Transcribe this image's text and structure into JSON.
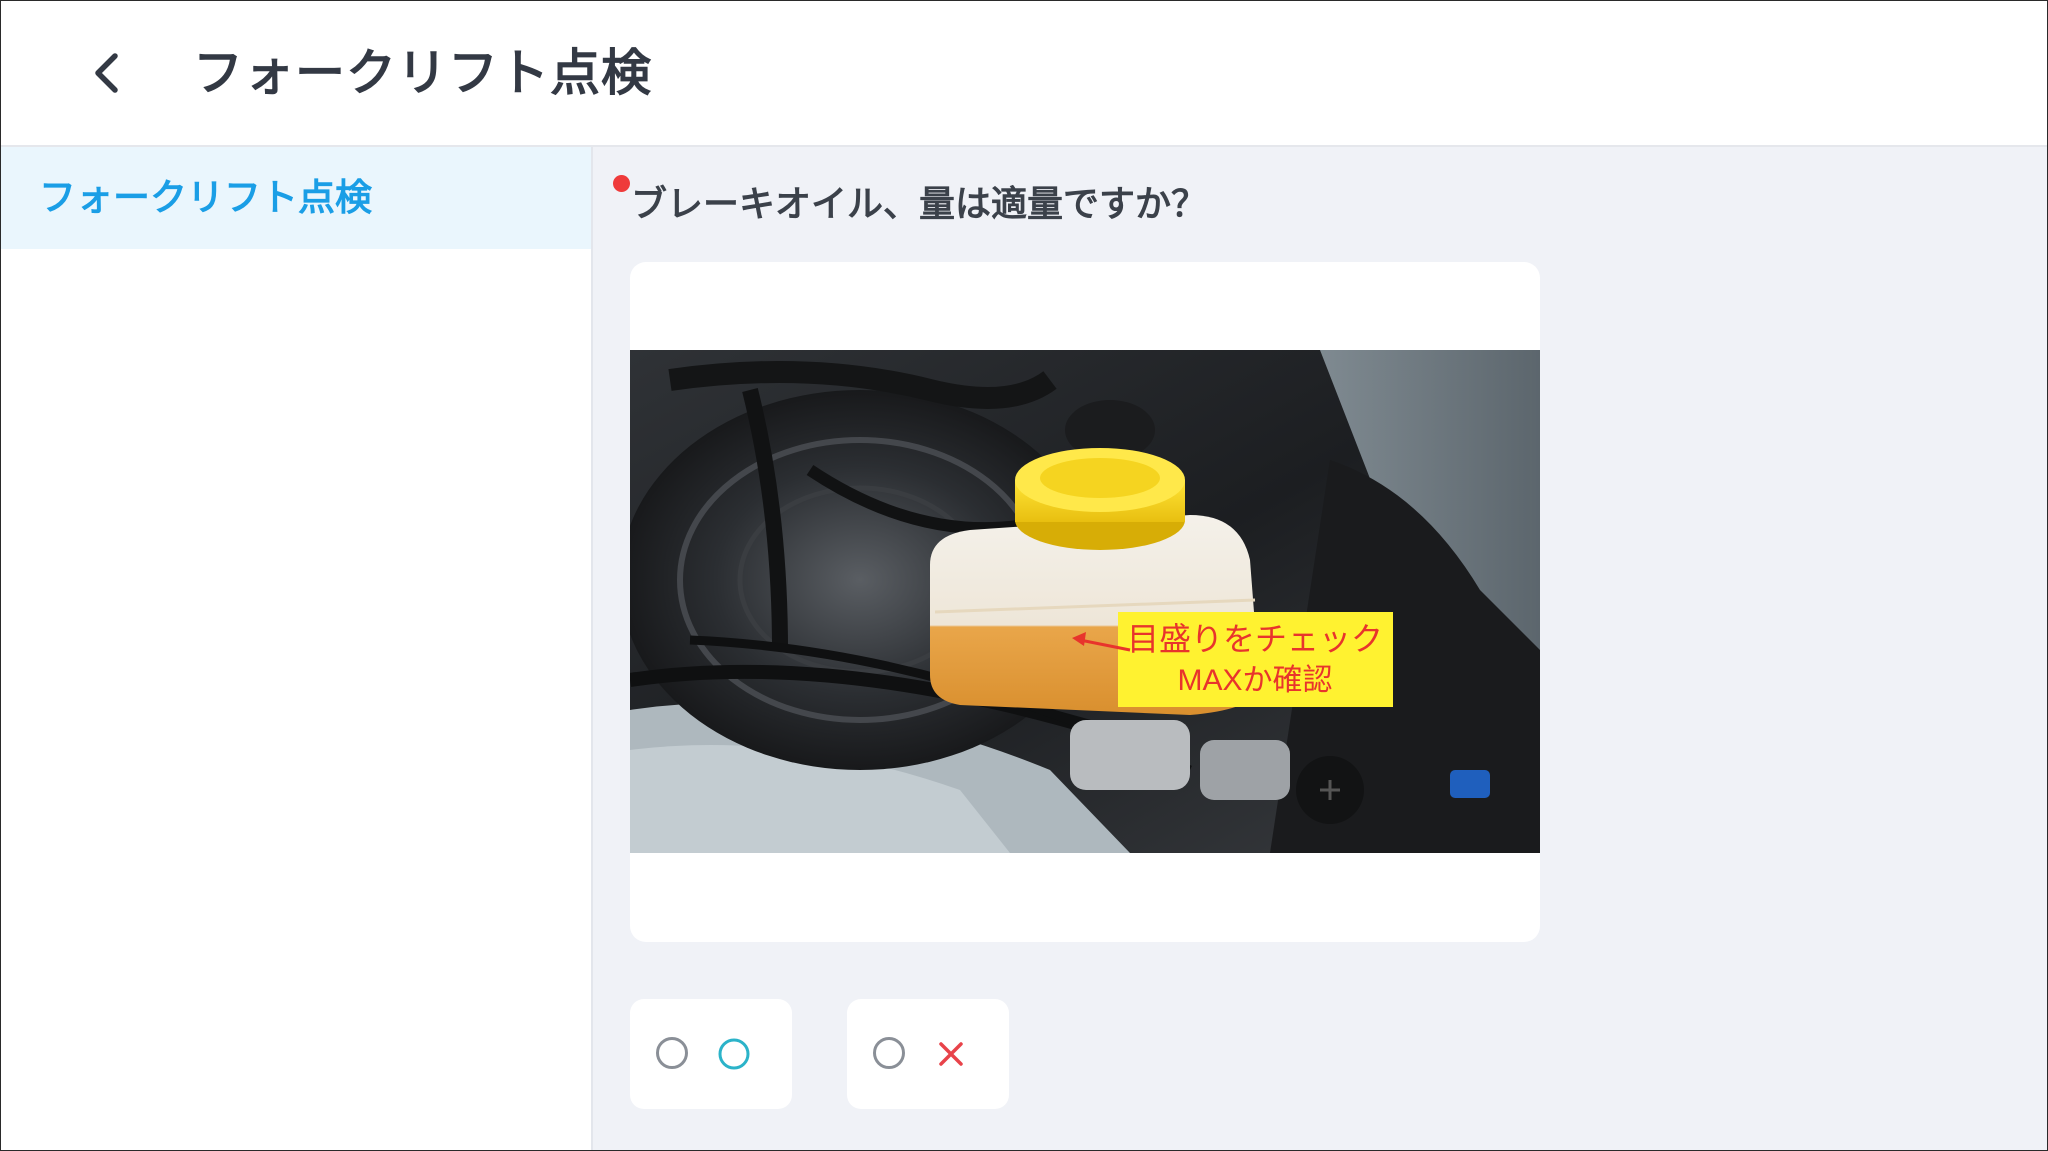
{
  "header": {
    "title": "フォークリフト点検",
    "back_icon": "chevron-left-icon"
  },
  "sidebar": {
    "items": [
      {
        "label": "フォークリフト点検",
        "active": true
      }
    ]
  },
  "question": {
    "text": "ブレーキオイル、量は適量ですか？",
    "required": true,
    "image": {
      "annotation_line1": "目盛りをチェック",
      "annotation_line2": "MAXか確認"
    },
    "options": [
      {
        "symbol": "◯",
        "icon": "circle-icon",
        "color": "#2bb3c9",
        "selected": false
      },
      {
        "symbol": "×",
        "icon": "cross-icon",
        "color": "#e8434a",
        "selected": false
      }
    ]
  },
  "colors": {
    "accent": "#1a9ee6",
    "sidebar_active_bg": "#eaf6fd",
    "main_bg": "#f0f2f7",
    "required": "#ef3b3b"
  }
}
